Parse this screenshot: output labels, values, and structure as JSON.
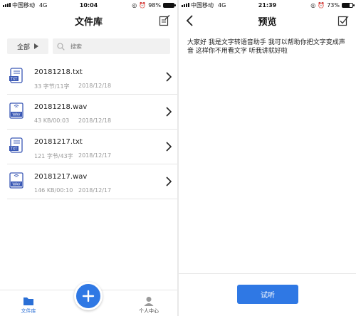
{
  "left": {
    "status": {
      "carrier": "中国移动",
      "network": "4G",
      "time": "10:04",
      "battery": "98%",
      "battery_level": 0.98
    },
    "nav": {
      "title": "文件库",
      "edit_icon": "edit-note-icon"
    },
    "filter": {
      "all_label": "全部",
      "search_placeholder": "搜索"
    },
    "files": [
      {
        "name": "20181218.txt",
        "meta": "33 字节/11字",
        "date": "2018/12/18",
        "icon": "txt-file-icon",
        "icon_label": "TXT"
      },
      {
        "name": "20181218.wav",
        "meta": "43 KB/00:03",
        "date": "2018/12/18",
        "icon": "wav-file-icon",
        "icon_label": "WAV"
      },
      {
        "name": "20181217.txt",
        "meta": "121 字节/43字",
        "date": "2018/12/17",
        "icon": "txt-file-icon",
        "icon_label": "TXT"
      },
      {
        "name": "20181217.wav",
        "meta": "146 KB/00:10",
        "date": "2018/12/17",
        "icon": "wav-file-icon",
        "icon_label": "WAV"
      }
    ],
    "tabbar": {
      "library_label": "文件库",
      "profile_label": "个人中心",
      "add_icon": "plus-icon"
    }
  },
  "right": {
    "status": {
      "carrier": "中国移动",
      "network": "4G",
      "time": "21:39",
      "battery": "73%",
      "battery_level": 0.73
    },
    "nav": {
      "title": "预览",
      "done_icon": "checkbox-check-icon"
    },
    "preview_text": "大家好 我是文字转语音助手 我可以帮助你把文字变成声音 这样你不用看文字 听我讲就好啦",
    "try_button": "试听"
  },
  "colors": {
    "accent": "#2f78e4",
    "text": "#222222",
    "muted": "#999999",
    "divider": "#e6e6e6"
  }
}
